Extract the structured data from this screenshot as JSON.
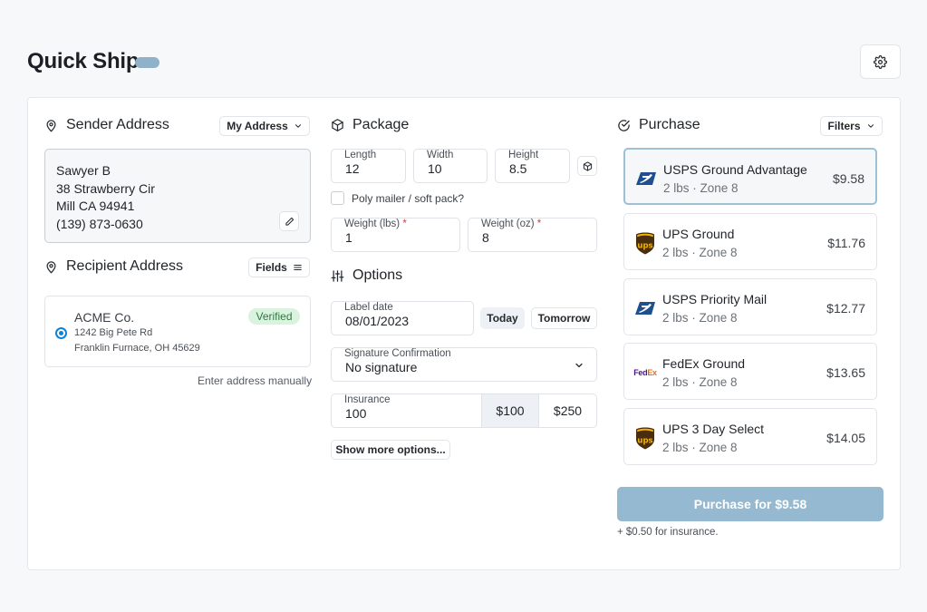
{
  "header": {
    "title": "Quick Ship"
  },
  "sender": {
    "title": "Sender Address",
    "address_select": "My Address",
    "lines": [
      "Sawyer B",
      "38 Strawberry Cir",
      "Mill CA 94941",
      "(139) 873-0630"
    ]
  },
  "recipient": {
    "title": "Recipient Address",
    "fields_button": "Fields",
    "name": "ACME Co.",
    "street": "1242 Big Pete Rd",
    "city": "Franklin Furnace, OH 45629",
    "badge": "Verified",
    "manual_link": "Enter address manually"
  },
  "package": {
    "title": "Package",
    "length_label": "Length",
    "length": "12",
    "width_label": "Width",
    "width": "10",
    "height_label": "Height",
    "height": "8.5",
    "poly_label": "Poly mailer / soft pack?",
    "weight_lbs_label": "Weight (lbs)",
    "weight_lbs": "1",
    "weight_oz_label": "Weight (oz)",
    "weight_oz": "8",
    "required_mark": "*"
  },
  "options": {
    "title": "Options",
    "label_date_label": "Label date",
    "label_date": "08/01/2023",
    "today": "Today",
    "tomorrow": "Tomorrow",
    "signature_label": "Signature Confirmation",
    "signature_value": "No signature",
    "insurance_label": "Insurance",
    "insurance_value": "100",
    "ins_opt_1": "$100",
    "ins_opt_2": "$250",
    "more_options": "Show more options..."
  },
  "purchase": {
    "title": "Purchase",
    "filters": "Filters",
    "rates": [
      {
        "carrier": "USPS Ground Advantage",
        "detail": "2 lbs · Zone 8",
        "price": "$9.58",
        "logo": "usps-eagle-icon"
      },
      {
        "carrier": "UPS Ground",
        "detail": "2 lbs · Zone 8",
        "price": "$11.76",
        "logo": "ups-shield-icon"
      },
      {
        "carrier": "USPS Priority Mail",
        "detail": "2 lbs · Zone 8",
        "price": "$12.77",
        "logo": "usps-eagle-icon"
      },
      {
        "carrier": "FedEx Ground",
        "detail": "2 lbs · Zone 8",
        "price": "$13.65",
        "logo": "fedex-logo"
      },
      {
        "carrier": "UPS 3 Day Select",
        "detail": "2 lbs · Zone 8",
        "price": "$14.05",
        "logo": "ups-shield-icon"
      }
    ],
    "button_label": "Purchase for $9.58",
    "insurance_note": "+ $0.50 for insurance.",
    "fedex_word_fed": "Fed",
    "fedex_word_ex": "Ex",
    "ups_word": "ups"
  },
  "colors": {
    "accent": "#95b9d0",
    "radio": "#0a84d6",
    "verified_bg": "#d9f3df",
    "ups_brown": "#4a2c0f",
    "ups_gold": "#f2b600",
    "usps_blue": "#1d4f91",
    "fedex_purple": "#4d148c",
    "fedex_orange": "#ff6600"
  }
}
